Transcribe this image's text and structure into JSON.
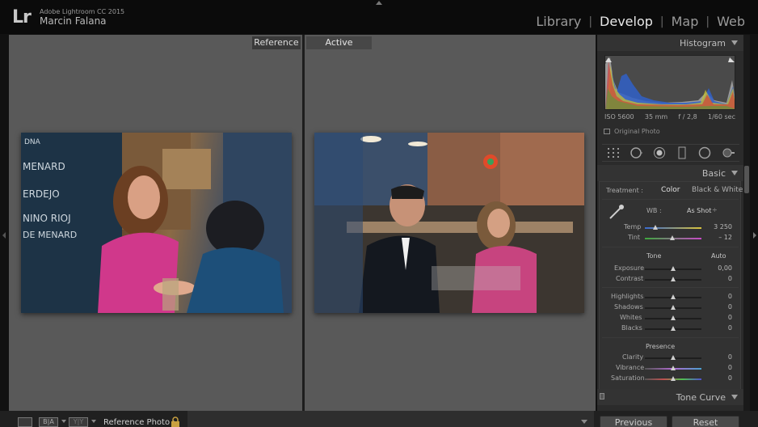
{
  "app": {
    "name": "Adobe Lightroom CC 2015",
    "user": "Marcin Falana",
    "logo": "Lr"
  },
  "modules": [
    {
      "label": "Library",
      "active": false
    },
    {
      "label": "Develop",
      "active": true
    },
    {
      "label": "Map",
      "active": false
    },
    {
      "label": "Web",
      "active": false
    }
  ],
  "view": {
    "reference_tag": "Reference",
    "active_tag": "Active"
  },
  "photos": {
    "reference_chalkboard": [
      "DNA",
      "MENARD",
      "ERDEJO",
      "NINO RIOJ",
      "DE MENARD"
    ]
  },
  "histogram": {
    "title": "Histogram",
    "iso": "ISO 5600",
    "focal": "35 mm",
    "aperture": "f / 2,8",
    "shutter": "1/60 sec",
    "original_photo": "Original Photo"
  },
  "basic": {
    "title": "Basic",
    "treatment_label": "Treatment :",
    "treatment_color": "Color",
    "treatment_bw": "Black & White",
    "wb_label": "WB :",
    "wb_value": "As Shot",
    "temp_label": "Temp",
    "temp_value": "3 250",
    "tint_label": "Tint",
    "tint_value": "– 12",
    "tone_label": "Tone",
    "auto_label": "Auto",
    "exposure_label": "Exposure",
    "exposure_value": "0,00",
    "contrast_label": "Contrast",
    "contrast_value": "0",
    "highlights_label": "Highlights",
    "highlights_value": "0",
    "shadows_label": "Shadows",
    "shadows_value": "0",
    "whites_label": "Whites",
    "whites_value": "0",
    "blacks_label": "Blacks",
    "blacks_value": "0",
    "presence_label": "Presence",
    "clarity_label": "Clarity",
    "clarity_value": "0",
    "vibrance_label": "Vibrance",
    "vibrance_value": "0",
    "saturation_label": "Saturation",
    "saturation_value": "0"
  },
  "tone_curve": {
    "title": "Tone Curve"
  },
  "bottom": {
    "ref_photo_label": "Reference Photo :",
    "ba_label": "B|A",
    "yy_label": "Y|Y",
    "previous": "Previous",
    "reset": "Reset"
  },
  "colors": {
    "panel_bg": "#2b2b2b",
    "center_bg": "#595959",
    "active_module": "#e8e8e8"
  }
}
